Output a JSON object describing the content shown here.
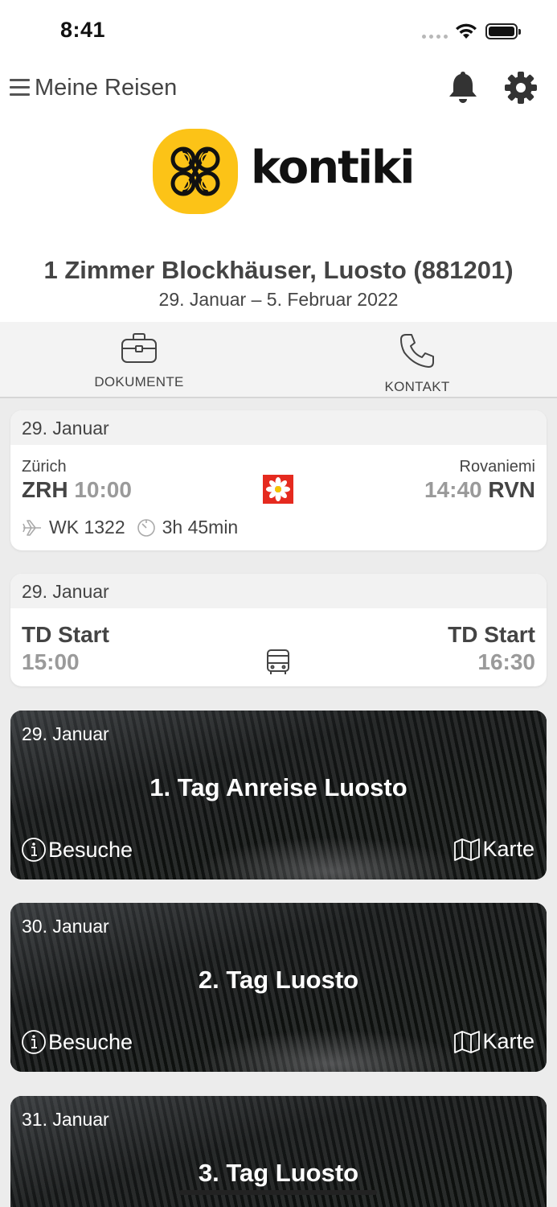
{
  "status_bar": {
    "time": "8:41"
  },
  "header": {
    "title": "Meine Reisen"
  },
  "logo": {
    "text": "kontiki",
    "color": "#fcc317"
  },
  "trip": {
    "title": "1 Zimmer Blockhäuser, Luosto (881201)",
    "dates": "29. Januar – 5. Februar 2022"
  },
  "actions": [
    {
      "label": "DOKUMENTE",
      "icon": "briefcase-icon"
    },
    {
      "label": "KONTAKT",
      "icon": "phone-icon"
    }
  ],
  "flight": {
    "date": "29. Januar",
    "from_city": "Zürich",
    "from_code": "ZRH",
    "departure_time": "10:00",
    "to_city": "Rovaniemi",
    "to_code": "RVN",
    "arrival_time": "14:40",
    "flight_number": "WK 1322",
    "duration": "3h 45min",
    "airline_color": "#e52a1f"
  },
  "transfer": {
    "date": "29. Januar",
    "from": "TD Start",
    "from_time": "15:00",
    "to": "TD Start",
    "to_time": "16:30"
  },
  "days": [
    {
      "date": "29. Januar",
      "title": "1. Tag Anreise Luosto",
      "visits_label": "Besuche",
      "map_label": "Karte"
    },
    {
      "date": "30. Januar",
      "title": "2. Tag Luosto",
      "visits_label": "Besuche",
      "map_label": "Karte"
    },
    {
      "date": "31. Januar",
      "title": "3. Tag Luosto"
    }
  ]
}
